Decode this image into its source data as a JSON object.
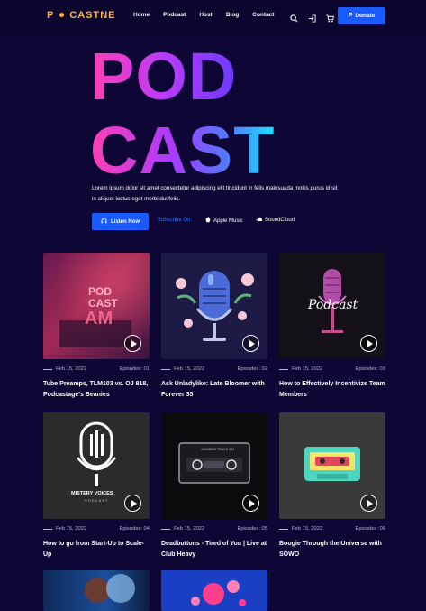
{
  "nav": {
    "logo_mark": "P",
    "logo_text": "CASTNE",
    "links": [
      "Home",
      "Podcast",
      "Host",
      "Blog",
      "Contact"
    ],
    "icons": [
      "search-icon",
      "login-icon",
      "cart-icon"
    ],
    "donate_label": "Donate",
    "donate_icon": "paypal-icon"
  },
  "hero": {
    "title_line1": "POD",
    "title_line2": "CAST",
    "description": "Lorem ipsum dolor sit amet consectetur adipiscing elit tincidunt in felis malesuada mollis purus id sit in aliquet lectus eget morbi dui felis.",
    "listen_label": "Listen Now",
    "subscribe_label": "Subscribe On:",
    "platforms": [
      {
        "label": "Apple Music",
        "icon": "apple-icon"
      },
      {
        "label": "SoundCloud",
        "icon": "soundcloud-icon"
      }
    ]
  },
  "episodes": [
    {
      "date": "Feb 15, 2022",
      "episode": "Episodes: 01",
      "title": "Tube Preamps, TLM103 vs. OJ 818, Podcastage's Beanies",
      "art_text": [
        "POD",
        "CAST",
        "AM"
      ]
    },
    {
      "date": "Feb 15, 2022",
      "episode": "Episodes: 02",
      "title": "Ask Unladylike: Late Bloomer with Forever 35"
    },
    {
      "date": "Feb 15, 2022",
      "episode": "Episodes: 03",
      "title": "How to Effectively Incentivize Team Members",
      "art_text": [
        "Podcast"
      ]
    },
    {
      "date": "Feb 15, 2022",
      "episode": "Episodes: 04",
      "title": "How to go from Start-Up to Scale-Up",
      "art_text": [
        "MISTERY VOICES",
        "PODCAST"
      ]
    },
    {
      "date": "Feb 15, 2022",
      "episode": "Episodes: 05",
      "title": "Deadbuttons - Tired of You | Live at Club Heavy",
      "art_text": [
        "JUNXBOX TRACK 001"
      ]
    },
    {
      "date": "Feb 15, 2022",
      "episode": "Episodes: 06",
      "title": "Boogie Through the Universe with SOWO"
    }
  ],
  "colors": {
    "background": "#0e0634",
    "accent_blue": "#1a5bff",
    "logo_orange": "#ffb43b",
    "hero_gradient": [
      "#ff3fb4",
      "#a83bff",
      "#1ee0ff"
    ]
  }
}
